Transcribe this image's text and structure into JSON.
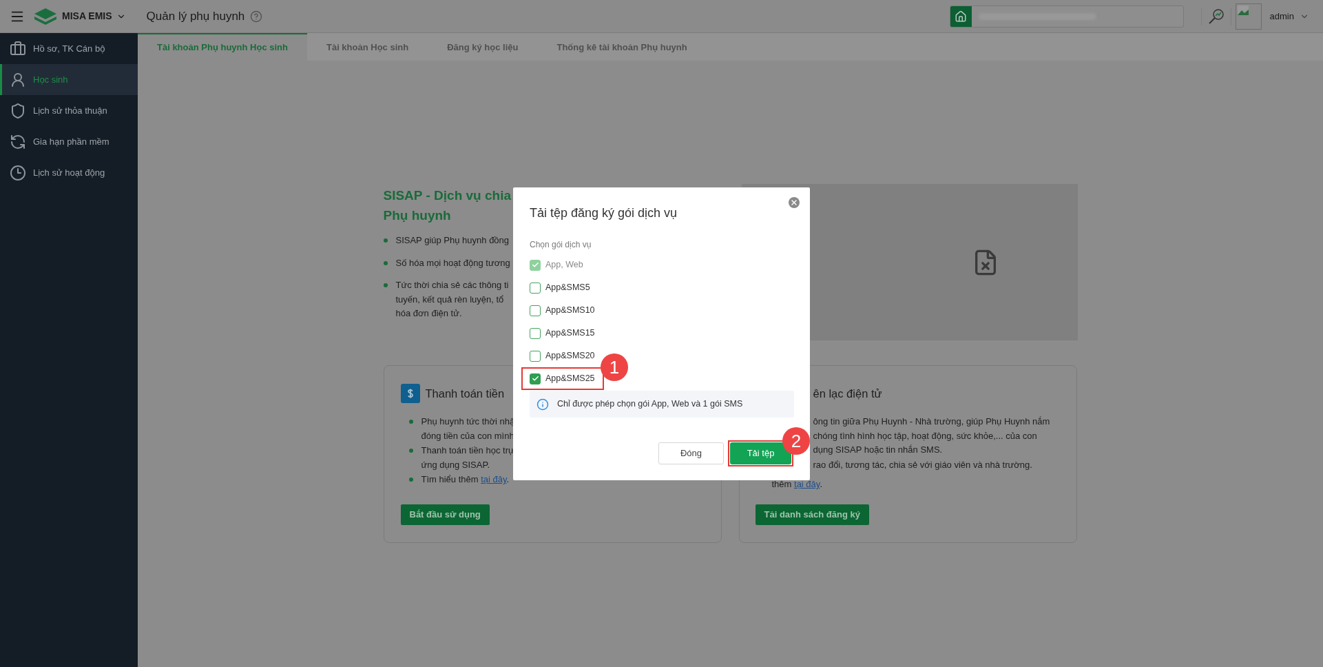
{
  "header": {
    "app_name": "MISA EMIS",
    "page_title": "Quản lý phụ huynh",
    "user": "admin"
  },
  "sidebar": {
    "items": [
      {
        "label": "Hồ sơ, TK Cán bộ",
        "selected": false
      },
      {
        "label": "Học sinh",
        "selected": true
      },
      {
        "label": "Lịch sử thỏa thuận",
        "selected": false
      },
      {
        "label": "Gia hạn phần mềm",
        "selected": false
      },
      {
        "label": "Lịch sử hoạt động",
        "selected": false
      }
    ]
  },
  "tabs": [
    {
      "label": "Tài khoản Phụ huynh Học sinh",
      "selected": true
    },
    {
      "label": "Tài khoản Học sinh",
      "selected": false
    },
    {
      "label": "Đăng ký học liệu",
      "selected": false
    },
    {
      "label": "Thống kê tài khoản Phụ huynh",
      "selected": false
    }
  ],
  "intro": {
    "title_lines": [
      "SISAP - Dịch vụ chia",
      "Phụ huynh"
    ],
    "bullets": [
      {
        "lines": [
          "SISAP giúp Phụ huynh đồng"
        ]
      },
      {
        "lines": [
          "Số hóa mọi hoạt động tương"
        ]
      },
      {
        "lines": [
          "Tức thời chia sẻ các thông ti",
          "tuyến, kết quả rèn luyện, tổ",
          "hóa đơn điện tử."
        ]
      }
    ]
  },
  "cards": [
    {
      "kind": "payment",
      "title": "Thanh toán tiền",
      "bullets": [
        {
          "lines": [
            "Phụ huynh tức thời nhậ",
            "đóng tiền của con mình"
          ]
        },
        {
          "lines": [
            "Thanh toán tiền học trự",
            "ứng dụng SISAP."
          ]
        },
        {
          "lines": [
            "Tìm hiểu thêm"
          ],
          "link": "tại đây",
          "suffix": "."
        }
      ],
      "button": "Bắt đầu sử dụng"
    },
    {
      "kind": "covered",
      "title": "ên lạc điện tử",
      "bullets": [
        {
          "lines": [
            "ông tin giữa Phụ Huynh - Nhà trường, giúp Phụ Huynh nắm",
            "chóng tình hình học tập, hoạt động, sức khỏe,... của con",
            "dụng SISAP hoặc tin nhắn SMS."
          ]
        },
        {
          "lines": [
            "rao đổi, tương tác, chia sẻ với giáo viên và nhà trường."
          ]
        },
        {
          "lines": [
            "thêm"
          ],
          "link": "tại đây",
          "suffix": "."
        }
      ],
      "button": "Tải danh sách đăng ký"
    }
  ],
  "modal": {
    "title": "Tải tệp đăng ký gói dịch vụ",
    "label": "Chọn gói dịch vụ",
    "options": [
      {
        "label": "App, Web",
        "checked": true,
        "disabled": true,
        "highlighted": false
      },
      {
        "label": "App&SMS5",
        "checked": false,
        "disabled": false,
        "highlighted": false
      },
      {
        "label": "App&SMS10",
        "checked": false,
        "disabled": false,
        "highlighted": false
      },
      {
        "label": "App&SMS15",
        "checked": false,
        "disabled": false,
        "highlighted": false
      },
      {
        "label": "App&SMS20",
        "checked": false,
        "disabled": false,
        "highlighted": false
      },
      {
        "label": "App&SMS25",
        "checked": true,
        "disabled": false,
        "highlighted": true,
        "annotation": "1"
      }
    ],
    "note": "Chỉ được phép chọn gói App, Web và 1 gói SMS",
    "buttons": [
      {
        "label": "Đóng",
        "kind": "secondary"
      },
      {
        "label": "Tải tệp",
        "kind": "primary",
        "annotation": "2"
      }
    ]
  }
}
